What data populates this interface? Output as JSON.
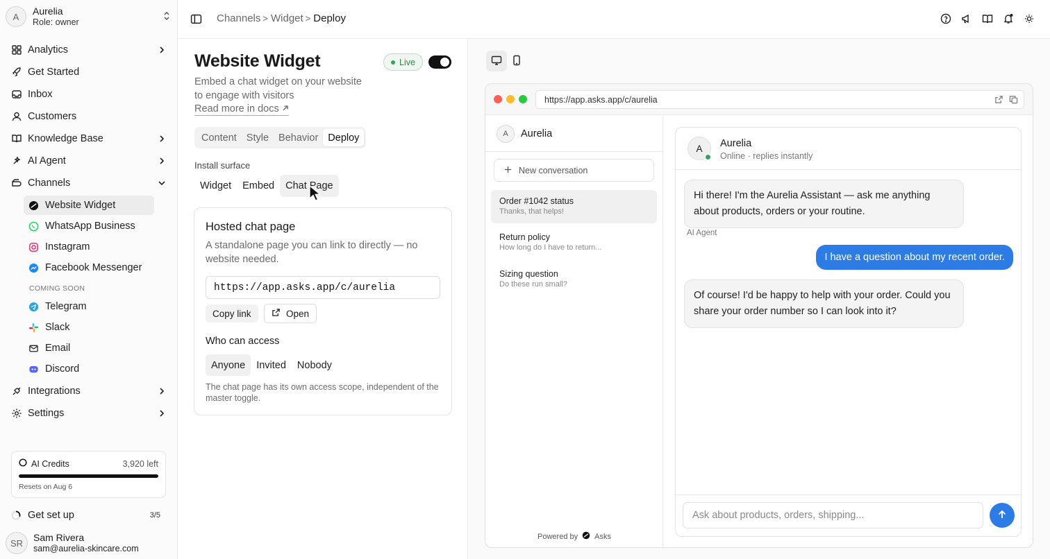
{
  "workspace": {
    "avatar": "A",
    "name": "Aurelia",
    "role": "Role: owner"
  },
  "sidebar": {
    "nav_top": [
      {
        "label": "Analytics",
        "icon": "grid-icon"
      },
      {
        "label": "Get Started",
        "icon": "rocket-icon"
      },
      {
        "label": "Inbox",
        "icon": "inbox-icon"
      },
      {
        "label": "Customers",
        "icon": "user-icon"
      },
      {
        "label": "Knowledge Base",
        "icon": "book-icon"
      },
      {
        "label": "AI Agent",
        "icon": "sparkles-icon"
      },
      {
        "label": "Channels",
        "icon": "layers-icon"
      }
    ],
    "channels": [
      {
        "label": "Website Widget",
        "icon": "asks-logo-icon"
      },
      {
        "label": "WhatsApp Business",
        "icon": "whatsapp-icon"
      },
      {
        "label": "Instagram",
        "icon": "instagram-icon"
      },
      {
        "label": "Facebook Messenger",
        "icon": "messenger-icon"
      }
    ],
    "coming_soon_label": "COMING SOON",
    "coming_soon": [
      {
        "label": "Telegram",
        "icon": "telegram-icon"
      },
      {
        "label": "Slack",
        "icon": "slack-icon"
      },
      {
        "label": "Email",
        "icon": "mail-icon"
      },
      {
        "label": "Discord",
        "icon": "discord-icon"
      }
    ],
    "nav_bottom": [
      {
        "label": "Integrations",
        "icon": "plug-icon"
      },
      {
        "label": "Settings",
        "icon": "gear-icon"
      }
    ],
    "credits": {
      "label": "AI Credits",
      "left": "3,920 left",
      "reset": "Resets on Aug 6",
      "used_fraction": 1.0
    },
    "get_set_up": {
      "label": "Get set up",
      "count": "3/5"
    },
    "user": {
      "initials": "SR",
      "name": "Sam Rivera",
      "email": "sam@aurelia-skincare.com"
    }
  },
  "breadcrumb": {
    "items": [
      "Channels",
      "Widget"
    ],
    "current": "Deploy"
  },
  "panel": {
    "title": "Website Widget",
    "live_label": "Live",
    "description": "Embed a chat widget on your website to engage with visitors",
    "docs_link": "Read more in docs",
    "tabs": [
      "Content",
      "Style",
      "Behavior",
      "Deploy"
    ],
    "active_tab": "Deploy",
    "install_label": "Install surface",
    "surfaces": [
      "Widget",
      "Embed",
      "Chat Page"
    ],
    "active_surface": "Chat Page",
    "card": {
      "title": "Hosted chat page",
      "description": "A standalone page you can link to directly — no website needed.",
      "url": "https://app.asks.app/c/aurelia",
      "copy_label": "Copy link",
      "open_label": "Open",
      "access_title": "Who can access",
      "access_options": [
        "Anyone",
        "Invited",
        "Nobody"
      ],
      "access_selected": "Anyone",
      "note": "The chat page has its own access scope, independent of the master toggle."
    }
  },
  "preview": {
    "address": "https://app.asks.app/c/aurelia",
    "brand": {
      "avatar": "A",
      "name": "Aurelia"
    },
    "new_conversation": "New conversation",
    "conversations": [
      {
        "title": "Order #1042 status",
        "sub": "Thanks, that helps!"
      },
      {
        "title": "Return policy",
        "sub": "How long do I have to return..."
      },
      {
        "title": "Sizing question",
        "sub": "Do these run small?"
      }
    ],
    "powered_by": "Powered by",
    "powered_brand": "Asks",
    "chat": {
      "avatar": "A",
      "name": "Aurelia",
      "status": "Online · replies instantly",
      "messages": {
        "bot1": "Hi there! I'm the Aurelia Assistant — ask me anything about products, orders or your routine.",
        "bot1_label": "AI Agent",
        "user1": "I have a question about my recent order.",
        "bot2": "Of course! I'd be happy to help with your order. Could you share your order number so I can look into it?"
      },
      "placeholder": "Ask about products, orders, shipping..."
    }
  },
  "colors": {
    "accent": "#2d7ce6",
    "live_green": "#35a35a",
    "toggle_on": "#111111"
  }
}
